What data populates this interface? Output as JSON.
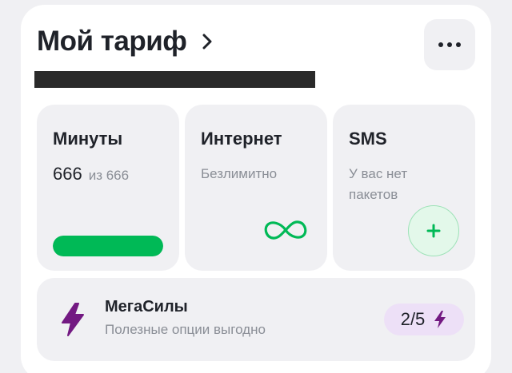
{
  "header": {
    "title": "Мой тариф",
    "menu_icon": "more-dots-icon",
    "chevron_icon": "chevron-right-icon"
  },
  "tiles": {
    "minutes": {
      "title": "Минуты",
      "value": "666",
      "of": "из 666",
      "progress_fraction": 1.0
    },
    "internet": {
      "title": "Интернет",
      "status": "Безлимитно",
      "icon": "infinity-icon"
    },
    "sms": {
      "title": "SMS",
      "status": "У вас нет пакетов",
      "add_icon": "plus-icon"
    }
  },
  "megasily": {
    "title": "МегаСилы",
    "subtitle": "Полезные опции выгодно",
    "count": "2/5",
    "icon": "lightning-icon"
  },
  "colors": {
    "accent_green": "#00b956",
    "accent_purple": "#731982",
    "badge_bg": "#ede0f7"
  }
}
